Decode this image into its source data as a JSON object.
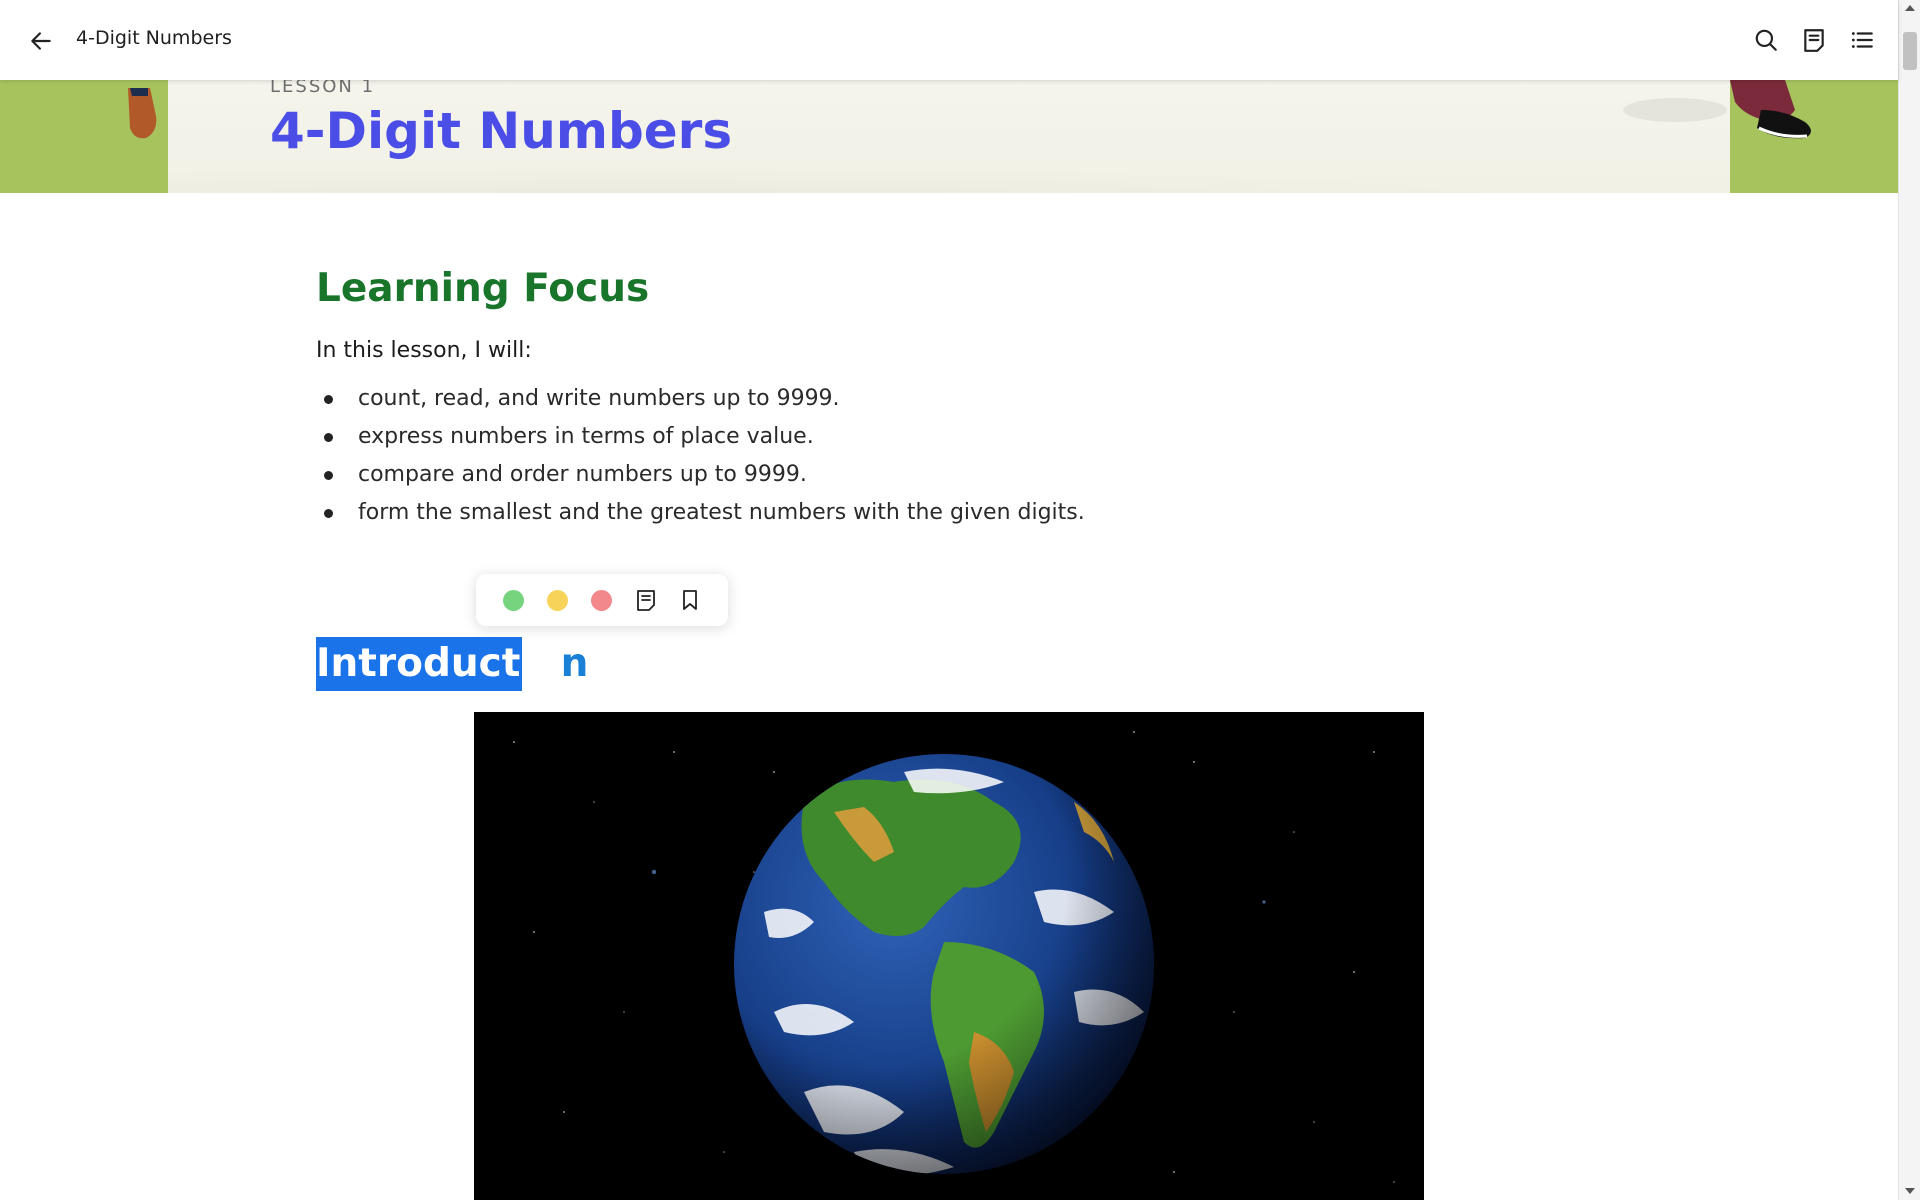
{
  "header": {
    "title": "4-Digit Numbers",
    "icons": [
      "back-arrow-icon",
      "search-icon",
      "notes-icon",
      "table-of-contents-icon"
    ]
  },
  "banner": {
    "lesson_label": "LESSON 1",
    "lesson_title": "4-Digit Numbers"
  },
  "learning_focus": {
    "heading": "Learning Focus",
    "lead": "In this lesson, I will:",
    "items": [
      "count, read, and write numbers up to 9999.",
      "express numbers in terms of place value.",
      "compare and order numbers up to 9999.",
      "form the smallest and the greatest numbers with the given digits."
    ]
  },
  "selection_toolbar": {
    "highlight_colors": [
      "#77d47e",
      "#f7d35a",
      "#f2878c"
    ],
    "icons": [
      "note-icon",
      "bookmark-icon"
    ]
  },
  "introduction": {
    "heading_selected": "Introductio",
    "heading_rest": "n"
  },
  "colors": {
    "lesson_title": "#4b4ee6",
    "focus_heading": "#18752a",
    "intro_heading": "#1a7fd6",
    "selection": "#1a73e8",
    "banner_green": "#a6c35e"
  }
}
